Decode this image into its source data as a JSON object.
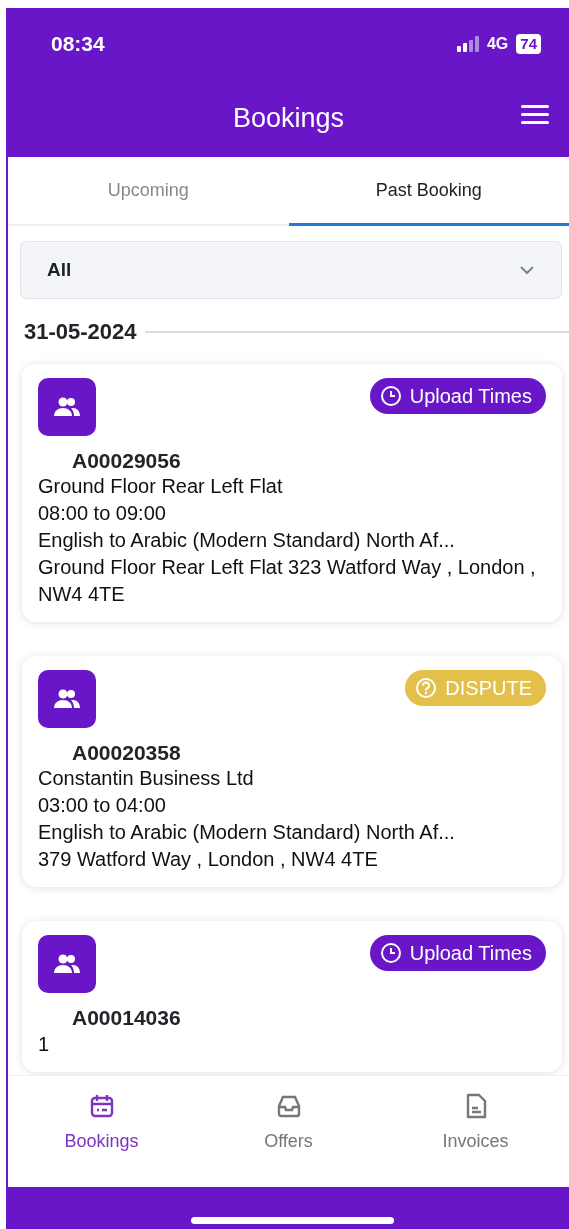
{
  "status_bar": {
    "time": "08:34",
    "network": "4G",
    "battery": "74"
  },
  "header": {
    "title": "Bookings"
  },
  "tabs": [
    {
      "label": "Upcoming",
      "selected": false
    },
    {
      "label": "Past Booking",
      "selected": true
    }
  ],
  "filter": {
    "value": "All"
  },
  "date_heading": "31-05-2024",
  "bookings": [
    {
      "ref": "A00029056",
      "action": {
        "kind": "upload",
        "label": "Upload Times"
      },
      "lines": [
        "Ground Floor Rear Left Flat",
        "08:00 to 09:00",
        "English to Arabic (Modern Standard) North Af...",
        "Ground Floor Rear Left Flat 323 Watford Way , London , NW4 4TE"
      ]
    },
    {
      "ref": "A00020358",
      "action": {
        "kind": "dispute",
        "label": "DISPUTE"
      },
      "lines": [
        "Constantin Business Ltd",
        "03:00 to 04:00",
        "English to Arabic (Modern Standard) North Af...",
        "379 Watford Way , London , NW4 4TE"
      ]
    },
    {
      "ref": "A00014036",
      "action": {
        "kind": "upload",
        "label": "Upload Times"
      },
      "lines": [
        "1"
      ]
    }
  ],
  "bottom_nav": [
    {
      "label": "Bookings",
      "selected": true
    },
    {
      "label": "Offers",
      "selected": false
    },
    {
      "label": "Invoices",
      "selected": false
    }
  ]
}
